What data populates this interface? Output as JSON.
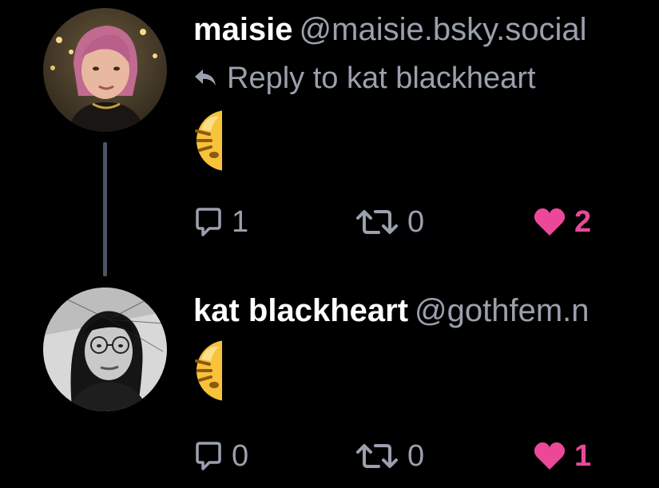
{
  "posts": [
    {
      "display_name": "maisie",
      "handle": "@maisie.bsky.social",
      "reply_to": "Reply to kat blackheart",
      "avatar": "profile-photo-pink-hair",
      "content_emoji": "emoji-face-partial",
      "replies": "1",
      "reposts": "0",
      "likes": "2",
      "liked": true
    },
    {
      "display_name": "kat blackheart",
      "handle": "@gothfem.n",
      "avatar": "profile-photo-grayscale",
      "content_emoji": "emoji-face-partial",
      "replies": "0",
      "reposts": "0",
      "likes": "1",
      "liked": true
    }
  ],
  "colors": {
    "background": "#000000",
    "text_primary": "#ffffff",
    "text_secondary": "#9aa0ad",
    "like": "#ec4899",
    "thread_line": "#4b5563"
  }
}
